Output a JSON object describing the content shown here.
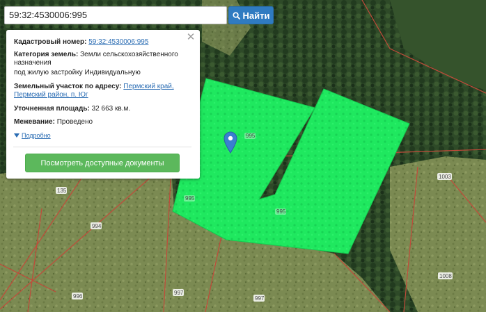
{
  "search": {
    "value": "59:32:4530006:995",
    "button_label": "Найти",
    "button_icon": "search-icon"
  },
  "info_panel": {
    "cadastral_label": "Кадастровый номер:",
    "cadastral_value": "59:32:4530006:995",
    "category_label": "Категория земель:",
    "category_value": "Земли сельскохозяйственного назначения",
    "usage_value": "под жилую застройку Индивидуальную",
    "address_label": "Земельный участок по адресу:",
    "address_value": "Пермский край, Пермский район, п. Юг",
    "area_label": "Уточненная площадь:",
    "area_value": "32 663 кв.м.",
    "survey_label": "Межевание:",
    "survey_value": "Проведено",
    "more_link": "Подробно",
    "docs_button": "Посмотреть доступные документы",
    "close_icon": "close-icon"
  },
  "map": {
    "plot_labels": [
      "995",
      "995",
      "995",
      "135",
      "994",
      "996",
      "997",
      "997",
      "1003",
      "1008"
    ],
    "selected_plot_color": "#1fe85f",
    "boundary_color": "#c24a3a",
    "marker_color": "#3a7fd0"
  }
}
